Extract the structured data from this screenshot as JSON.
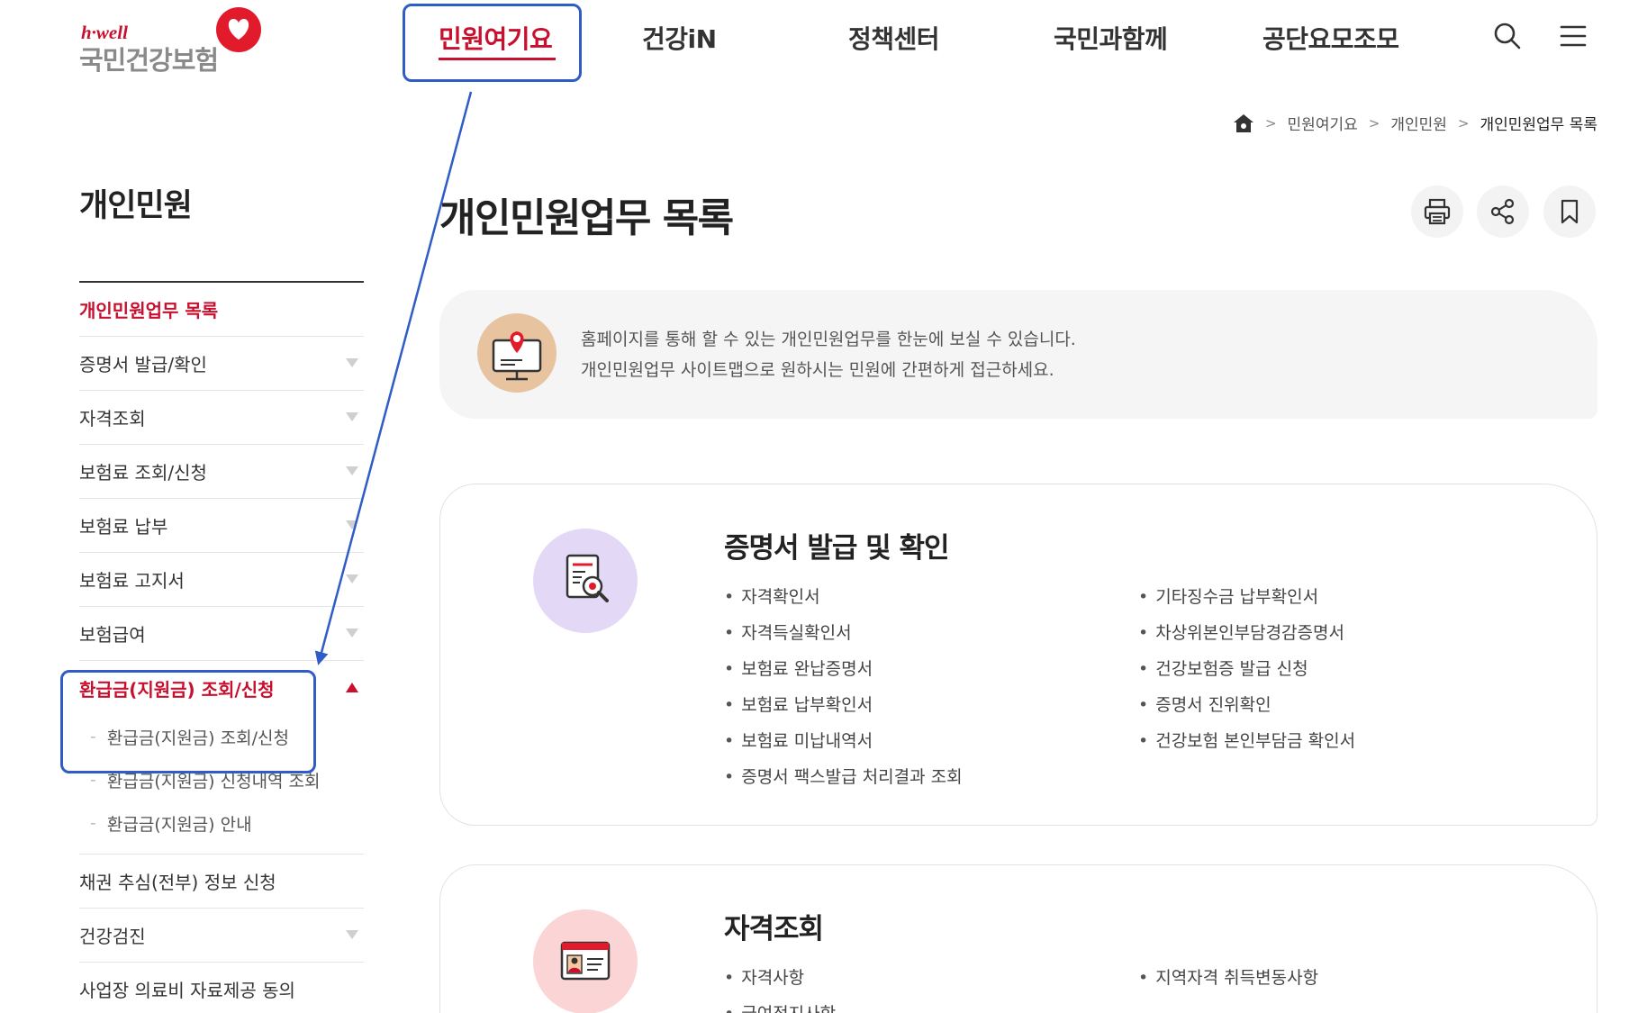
{
  "header": {
    "logo_top": "h·well",
    "logo_main": "국민건강보험",
    "nav": [
      "민원여기요",
      "건강iN",
      "정책센터",
      "국민과함께",
      "공단요모조모"
    ],
    "active_nav": "민원여기요",
    "icons": [
      "search-icon",
      "hamburger-menu-icon"
    ]
  },
  "breadcrumb": {
    "icon": "home-icon",
    "items": [
      "민원여기요",
      "개인민원",
      "개인민원업무 목록"
    ]
  },
  "sidebar": {
    "title": "개인민원",
    "items": [
      {
        "label": "개인민원업무 목록",
        "active": true
      },
      {
        "label": "증명서 발급/확인"
      },
      {
        "label": "자격조회"
      },
      {
        "label": "보험료 조회/신청"
      },
      {
        "label": "보험료 납부"
      },
      {
        "label": "보험료 고지서"
      },
      {
        "label": "보험급여"
      },
      {
        "label": "환급금(지원금) 조회/신청",
        "active": true,
        "expanded": true,
        "children": [
          "환급금(지원금) 조회/신청",
          "환급금(지원금) 신청내역 조회",
          "환급금(지원금) 안내"
        ]
      },
      {
        "label": "채권 추심(전부) 정보 신청"
      },
      {
        "label": "건강검진"
      },
      {
        "label": "사업장 의료비 자료제공 동의"
      }
    ]
  },
  "main": {
    "title": "개인민원업무 목록",
    "tools": [
      "print-icon",
      "share-icon",
      "bookmark-icon"
    ],
    "intro": {
      "line1": "홈페이지를 통해 할 수 있는 개인민원업무를 한눈에 보실 수 있습니다.",
      "line2": "개인민원업무 사이트맵으로 원하시는 민원에 간편하게 접근하세요."
    },
    "sections": [
      {
        "title": "증명서 발급 및 확인",
        "icon": "certificate-search-icon",
        "left": [
          "자격확인서",
          "자격득실확인서",
          "보험료 완납증명서",
          "보험료 납부확인서",
          "보험료 미납내역서",
          "증명서 팩스발급 처리결과 조회"
        ],
        "right": [
          "기타징수금 납부확인서",
          "차상위본인부담경감증명서",
          "건강보험증 발급 신청",
          "증명서 진위확인",
          "건강보험 본인부담금 확인서"
        ]
      },
      {
        "title": "자격조회",
        "icon": "id-card-icon",
        "left": [
          "자격사항",
          "급여정지사항"
        ],
        "right": [
          "지역자격 취득변동사항"
        ]
      }
    ]
  },
  "colors": {
    "brand_red": "#c8102e",
    "annotation_blue": "#2f5cc7",
    "intro_bg": "#f5f5f5",
    "cert_icon_bg": "#e3d9f7",
    "idcard_icon_bg": "#fbd4d6"
  }
}
